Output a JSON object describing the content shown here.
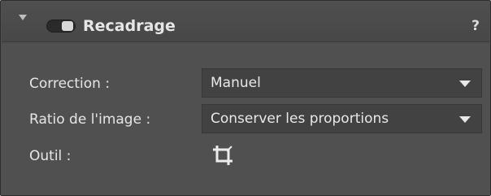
{
  "panel": {
    "title": "Recadrage",
    "help_label": "?",
    "enabled": true
  },
  "fields": {
    "correction": {
      "label": "Correction :",
      "value": "Manuel"
    },
    "ratio": {
      "label": "Ratio de l'image :",
      "value": "Conserver les proportions"
    },
    "tool": {
      "label": "Outil :",
      "icon": "crop-icon"
    }
  },
  "icons": {
    "collapse": "triangle-down-icon",
    "dropdown": "chevron-down-icon",
    "toggle": "toggle-switch-icon"
  },
  "colors": {
    "panel_bg": "#505050",
    "field_bg": "#424242",
    "text": "#e6e6e6"
  }
}
